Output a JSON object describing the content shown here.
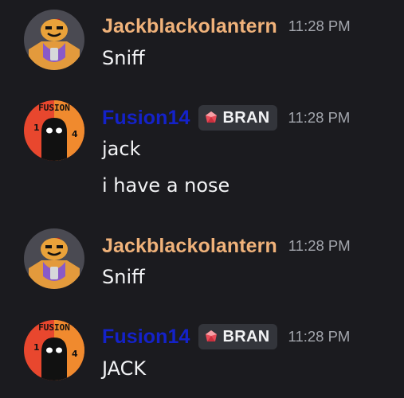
{
  "colors": {
    "background": "#1b1b1f",
    "jack_name": "#f0b27a",
    "fusion_name": "#1422c9",
    "timestamp": "#a3a6ad",
    "message_text": "#f2f3f5",
    "tag_background": "#33353b"
  },
  "messages": [
    {
      "author": "Jackblackolantern",
      "time": "11:28 PM",
      "lines": [
        "Sniff"
      ]
    },
    {
      "author": "Fusion14",
      "tag": "BRAN",
      "tag_icon": "red-gem-icon",
      "time": "11:28 PM",
      "lines": [
        "jack",
        "i have a nose"
      ]
    },
    {
      "author": "Jackblackolantern",
      "time": "11:28 PM",
      "lines": [
        "Sniff"
      ]
    },
    {
      "author": "Fusion14",
      "tag": "BRAN",
      "tag_icon": "red-gem-icon",
      "time": "11:28 PM",
      "lines": [
        "JACK"
      ]
    }
  ],
  "avatars": {
    "jack_avatar_text": "",
    "fusion_avatar_text": "FUSION",
    "fusion_avatar_digits": [
      "1",
      "4"
    ]
  }
}
